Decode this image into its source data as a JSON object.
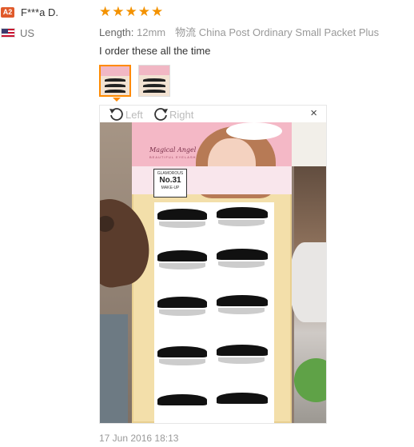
{
  "reviewer": {
    "badge": "A2",
    "name": "F***a D.",
    "country": "US"
  },
  "rating": {
    "stars": 5,
    "max": 5
  },
  "meta": {
    "length_label": "Length:",
    "length_value": "12mm",
    "shipping": "物流 China Post Ordinary Small Packet Plus"
  },
  "review": {
    "text": "I order these all the time"
  },
  "viewer": {
    "rotate_left_label": "Left",
    "rotate_right_label": "Right",
    "close_glyph": "×"
  },
  "product_photo": {
    "brand": "Magical Angel",
    "brand_sub": "BEAUTIFUL EYELASH",
    "badge_top": "GLAMOROUS",
    "badge_main": "No.31",
    "badge_bottom": "MAKE-UP"
  },
  "timestamp": "17 Jun 2016 18:13",
  "colors": {
    "accent": "#ff8a00",
    "star": "#f39200",
    "badge": "#e05a2b"
  }
}
